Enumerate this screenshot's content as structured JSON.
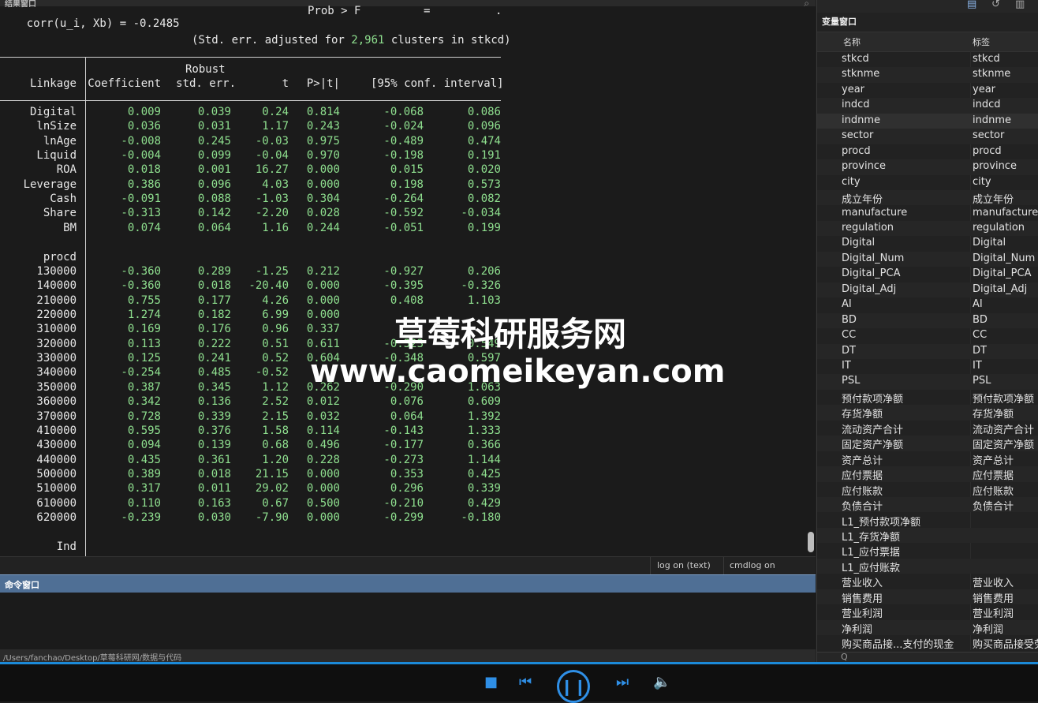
{
  "results": {
    "title": "结果窗口",
    "top_line_left": "corr(u_i, Xb) = -0.2485",
    "top_line_mid": "Prob > F",
    "top_line_eq": "=",
    "top_line_dot": ".",
    "se_note_prefix": "(Std. err. adjusted for ",
    "se_note_num": "2,961",
    "se_note_suffix": " clusters in stkcd)",
    "header": {
      "depvar": "Linkage",
      "coef": "Coefficient",
      "robust": "Robust",
      "se": "std. err.",
      "t": "t",
      "p": "P>|t|",
      "ci": "[95% conf. interval]"
    },
    "rows_a": [
      {
        "name": "Digital",
        "coef": "0.009",
        "se": "0.039",
        "t": "0.24",
        "p": "0.814",
        "lo": "-0.068",
        "hi": "0.086"
      },
      {
        "name": "lnSize",
        "coef": "0.036",
        "se": "0.031",
        "t": "1.17",
        "p": "0.243",
        "lo": "-0.024",
        "hi": "0.096"
      },
      {
        "name": "lnAge",
        "coef": "-0.008",
        "se": "0.245",
        "t": "-0.03",
        "p": "0.975",
        "lo": "-0.489",
        "hi": "0.474"
      },
      {
        "name": "Liquid",
        "coef": "-0.004",
        "se": "0.099",
        "t": "-0.04",
        "p": "0.970",
        "lo": "-0.198",
        "hi": "0.191"
      },
      {
        "name": "ROA",
        "coef": "0.018",
        "se": "0.001",
        "t": "16.27",
        "p": "0.000",
        "lo": "0.015",
        "hi": "0.020"
      },
      {
        "name": "Leverage",
        "coef": "0.386",
        "se": "0.096",
        "t": "4.03",
        "p": "0.000",
        "lo": "0.198",
        "hi": "0.573"
      },
      {
        "name": "Cash",
        "coef": "-0.091",
        "se": "0.088",
        "t": "-1.03",
        "p": "0.304",
        "lo": "-0.264",
        "hi": "0.082"
      },
      {
        "name": "Share",
        "coef": "-0.313",
        "se": "0.142",
        "t": "-2.20",
        "p": "0.028",
        "lo": "-0.592",
        "hi": "-0.034"
      },
      {
        "name": "BM",
        "coef": "0.074",
        "se": "0.064",
        "t": "1.16",
        "p": "0.244",
        "lo": "-0.051",
        "hi": "0.199"
      }
    ],
    "group_label": "procd",
    "rows_b": [
      {
        "name": "130000",
        "coef": "-0.360",
        "se": "0.289",
        "t": "-1.25",
        "p": "0.212",
        "lo": "-0.927",
        "hi": "0.206"
      },
      {
        "name": "140000",
        "coef": "-0.360",
        "se": "0.018",
        "t": "-20.40",
        "p": "0.000",
        "lo": "-0.395",
        "hi": "-0.326"
      },
      {
        "name": "210000",
        "coef": "0.755",
        "se": "0.177",
        "t": "4.26",
        "p": "0.000",
        "lo": "0.408",
        "hi": "1.103"
      },
      {
        "name": "220000",
        "coef": "1.274",
        "se": "0.182",
        "t": "6.99",
        "p": "0.000",
        "lo": "",
        "hi": ""
      },
      {
        "name": "310000",
        "coef": "0.169",
        "se": "0.176",
        "t": "0.96",
        "p": "0.337",
        "lo": "",
        "hi": ""
      },
      {
        "name": "320000",
        "coef": "0.113",
        "se": "0.222",
        "t": "0.51",
        "p": "0.611",
        "lo": "-0.323",
        "hi": "0.549"
      },
      {
        "name": "330000",
        "coef": "0.125",
        "se": "0.241",
        "t": "0.52",
        "p": "0.604",
        "lo": "-0.348",
        "hi": "0.597"
      },
      {
        "name": "340000",
        "coef": "-0.254",
        "se": "0.485",
        "t": "-0.52",
        "p": "",
        "lo": "",
        "hi": ""
      },
      {
        "name": "350000",
        "coef": "0.387",
        "se": "0.345",
        "t": "1.12",
        "p": "0.262",
        "lo": "-0.290",
        "hi": "1.063"
      },
      {
        "name": "360000",
        "coef": "0.342",
        "se": "0.136",
        "t": "2.52",
        "p": "0.012",
        "lo": "0.076",
        "hi": "0.609"
      },
      {
        "name": "370000",
        "coef": "0.728",
        "se": "0.339",
        "t": "2.15",
        "p": "0.032",
        "lo": "0.064",
        "hi": "1.392"
      },
      {
        "name": "410000",
        "coef": "0.595",
        "se": "0.376",
        "t": "1.58",
        "p": "0.114",
        "lo": "-0.143",
        "hi": "1.333"
      },
      {
        "name": "430000",
        "coef": "0.094",
        "se": "0.139",
        "t": "0.68",
        "p": "0.496",
        "lo": "-0.177",
        "hi": "0.366"
      },
      {
        "name": "440000",
        "coef": "0.435",
        "se": "0.361",
        "t": "1.20",
        "p": "0.228",
        "lo": "-0.273",
        "hi": "1.144"
      },
      {
        "name": "500000",
        "coef": "0.389",
        "se": "0.018",
        "t": "21.15",
        "p": "0.000",
        "lo": "0.353",
        "hi": "0.425"
      },
      {
        "name": "510000",
        "coef": "0.317",
        "se": "0.011",
        "t": "29.02",
        "p": "0.000",
        "lo": "0.296",
        "hi": "0.339"
      },
      {
        "name": "610000",
        "coef": "0.110",
        "se": "0.163",
        "t": "0.67",
        "p": "0.500",
        "lo": "-0.210",
        "hi": "0.429"
      },
      {
        "name": "620000",
        "coef": "-0.239",
        "se": "0.030",
        "t": "-7.90",
        "p": "0.000",
        "lo": "-0.299",
        "hi": "-0.180"
      }
    ],
    "ind_label": "Ind",
    "status_log": "log on (text)",
    "status_cmdlog": "cmdlog on"
  },
  "command": {
    "title": "命令窗口",
    "path": "/Users/fanchao/Desktop/草莓科研网/数据与代码"
  },
  "variables": {
    "title": "变量窗口",
    "col_name": "名称",
    "col_label": "标签",
    "filter_placeholder": "Q",
    "rows": [
      {
        "name": "stkcd",
        "label": "stkcd"
      },
      {
        "name": "stknme",
        "label": "stknme"
      },
      {
        "name": "year",
        "label": "year"
      },
      {
        "name": "indcd",
        "label": "indcd"
      },
      {
        "name": "indnme",
        "label": "indnme"
      },
      {
        "name": "sector",
        "label": "sector"
      },
      {
        "name": "procd",
        "label": "procd"
      },
      {
        "name": "province",
        "label": "province"
      },
      {
        "name": "city",
        "label": "city"
      },
      {
        "name": "成立年份",
        "label": "成立年份"
      },
      {
        "name": "manufacture",
        "label": "manufacture"
      },
      {
        "name": "regulation",
        "label": "regulation"
      },
      {
        "name": "Digital",
        "label": "Digital"
      },
      {
        "name": "Digital_Num",
        "label": "Digital_Num"
      },
      {
        "name": "Digital_PCA",
        "label": "Digital_PCA"
      },
      {
        "name": "Digital_Adj",
        "label": "Digital_Adj"
      },
      {
        "name": "AI",
        "label": "AI"
      },
      {
        "name": "BD",
        "label": "BD"
      },
      {
        "name": "CC",
        "label": "CC"
      },
      {
        "name": "DT",
        "label": "DT"
      },
      {
        "name": "IT",
        "label": "IT"
      },
      {
        "name": "PSL",
        "label": "PSL"
      },
      {
        "name": "预付款项净额",
        "label": "预付款项净额"
      },
      {
        "name": "存货净额",
        "label": "存货净额"
      },
      {
        "name": "流动资产合计",
        "label": "流动资产合计"
      },
      {
        "name": "固定资产净额",
        "label": "固定资产净额"
      },
      {
        "name": "资产总计",
        "label": "资产总计"
      },
      {
        "name": "应付票据",
        "label": "应付票据"
      },
      {
        "name": "应付账款",
        "label": "应付账款"
      },
      {
        "name": "负债合计",
        "label": "负债合计"
      },
      {
        "name": "L1_预付款项净额",
        "label": ""
      },
      {
        "name": "L1_存货净额",
        "label": ""
      },
      {
        "name": "L1_应付票据",
        "label": ""
      },
      {
        "name": "L1_应付账款",
        "label": ""
      },
      {
        "name": "营业收入",
        "label": "营业收入"
      },
      {
        "name": "销售费用",
        "label": "销售费用"
      },
      {
        "name": "营业利润",
        "label": "营业利润"
      },
      {
        "name": "净利润",
        "label": "净利润"
      },
      {
        "name": "购买商品接...支付的现金",
        "label": "购买商品接受劳"
      }
    ]
  },
  "watermark": {
    "cn": "草莓科研服务网",
    "url": "www.caomeikeyan.com"
  },
  "player": {
    "stop_icon": "stop-icon",
    "prev_icon": "skip-back-icon",
    "pause_icon": "pause-icon",
    "next_icon": "skip-forward-icon",
    "volume_icon": "volume-icon",
    "accent": "#2f8fe6"
  }
}
